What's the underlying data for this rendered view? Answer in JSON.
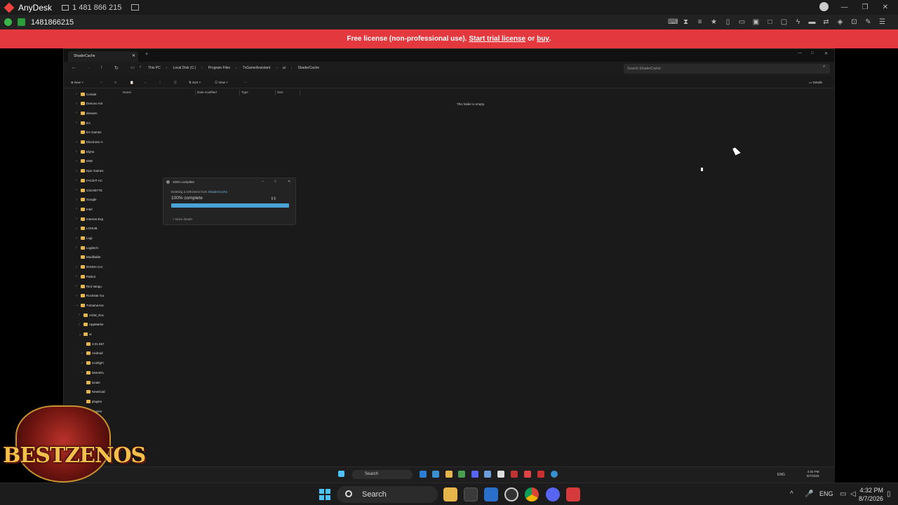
{
  "anydesk": {
    "app_name": "AnyDesk",
    "remote_address": "1 481 866 215",
    "session_id": "1481866215",
    "banner": {
      "prefix": "Free license (non-professional use).",
      "trial_link": "Start trial license",
      "or": "or",
      "buy_link": "buy",
      "suffix": "."
    }
  },
  "explorer": {
    "tab_title": "ShaderCache",
    "breadcrumb": [
      "This PC",
      "Local Disk (C:)",
      "Program Files",
      "TxGameAssistant",
      "ui",
      "ShaderCache"
    ],
    "search_placeholder": "Search ShaderCache",
    "commands": {
      "new": "New",
      "sort": "Sort",
      "view": "View",
      "details": "Details"
    },
    "columns": [
      "Name",
      "Date modified",
      "Type",
      "Size"
    ],
    "empty_message": "This folder is empty.",
    "tree": [
      {
        "label": "Corsair",
        "indent": 0,
        "chev": "›"
      },
      {
        "label": "Denuvo Ant",
        "indent": 0,
        "chev": "›"
      },
      {
        "label": "dexwen",
        "indent": 0,
        "chev": "›"
      },
      {
        "label": "EA",
        "indent": 0,
        "chev": "›"
      },
      {
        "label": "EA Games",
        "indent": 0,
        "chev": ""
      },
      {
        "label": "Electronic A",
        "indent": 0,
        "chev": "›"
      },
      {
        "label": "Elyhe",
        "indent": 0,
        "chev": "›"
      },
      {
        "label": "ENE",
        "indent": 0,
        "chev": "›"
      },
      {
        "label": "Epic Games",
        "indent": 0,
        "chev": "›"
      },
      {
        "label": "FACEIT AC",
        "indent": 0,
        "chev": "›"
      },
      {
        "label": "GIGABYTE",
        "indent": 0,
        "chev": "›"
      },
      {
        "label": "Google",
        "indent": 0,
        "chev": "›"
      },
      {
        "label": "Intel",
        "indent": 0,
        "chev": "›"
      },
      {
        "label": "Internet Exp",
        "indent": 0,
        "chev": "›"
      },
      {
        "label": "LGHUB",
        "indent": 0,
        "chev": "›"
      },
      {
        "label": "Logi",
        "indent": 0,
        "chev": "›"
      },
      {
        "label": "Logitech",
        "indent": 0,
        "chev": "›"
      },
      {
        "label": "Modifiable",
        "indent": 0,
        "chev": ""
      },
      {
        "label": "NVIDIA Cor",
        "indent": 0,
        "chev": "›"
      },
      {
        "label": "Patriot",
        "indent": 0,
        "chev": "›"
      },
      {
        "label": "Riot Vangu",
        "indent": 0,
        "chev": "›"
      },
      {
        "label": "Rockstar Ga",
        "indent": 0,
        "chev": "›"
      },
      {
        "label": "TxGameAss",
        "indent": 0,
        "chev": "⌄"
      },
      {
        "label": "AOW_Roc",
        "indent": 1,
        "chev": "›"
      },
      {
        "label": "AppMarke",
        "indent": 1,
        "chev": "›"
      },
      {
        "label": "ui",
        "indent": 1,
        "chev": "⌄"
      },
      {
        "label": "3.01.557",
        "indent": 2,
        "chev": ""
      },
      {
        "label": "Android",
        "indent": 2,
        "chev": "›"
      },
      {
        "label": "ConfigFi",
        "indent": 2,
        "chev": "›"
      },
      {
        "label": "DMAIRs",
        "indent": 2,
        "chev": "›"
      },
      {
        "label": "locale",
        "indent": 2,
        "chev": ""
      },
      {
        "label": "NewGuid",
        "indent": 2,
        "chev": ""
      },
      {
        "label": "plugins",
        "indent": 2,
        "chev": ""
      },
      {
        "label": "plugins",
        "indent": 2,
        "chev": ""
      }
    ]
  },
  "progress_dialog": {
    "title": "100% complete",
    "info_prefix": "Deleting 2,109 items from",
    "info_folder": "ShaderCache",
    "percent_label": "100% complete",
    "progress": 1.0,
    "more_details": "More details"
  },
  "remote_taskbar": {
    "search": "Search",
    "lang": "ENG",
    "time": "4:32 PM",
    "date": "8/7/2026"
  },
  "taskbar": {
    "search": "Search",
    "lang": "ENG",
    "time": "4:32 PM",
    "date": "8/7/2026"
  },
  "overlay": {
    "logo_text": "BESTZENOS"
  },
  "colors": {
    "banner": "#e4383f",
    "accent": "#4cc2ff",
    "progress": "#4aa3d6",
    "folder": "#e7b64a"
  }
}
